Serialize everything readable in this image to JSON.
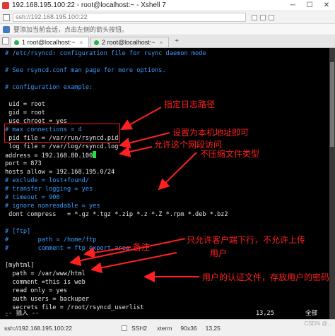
{
  "window": {
    "title": "192.168.195.100:22 - root@localhost:~ - Xshell 7",
    "minimize": "─",
    "maximize": "☐",
    "close": "✕"
  },
  "address_bar": {
    "value": "ssh://192.168.195.100:22"
  },
  "hint": {
    "text": "要添加当前会话，点击左侧的箭头按钮。"
  },
  "tabs": [
    {
      "label": "1 root@localhost:~",
      "close": "×",
      "dot_color": "#2ab24a"
    },
    {
      "label": "2 root@localhost:~",
      "close": "×",
      "dot_color": "#2ab24a"
    }
  ],
  "tab_add": "+",
  "terminal": {
    "lines": [
      {
        "text": "# /etc/rsyncd: configuration file for rsync daemon mode",
        "kind": "comment"
      },
      {
        "text": "",
        "kind": "text"
      },
      {
        "text": "# See rsyncd.conf man page for more options.",
        "kind": "comment"
      },
      {
        "text": "",
        "kind": "text"
      },
      {
        "text": "# configuration example:",
        "kind": "comment"
      },
      {
        "text": "",
        "kind": "text"
      },
      {
        "text": " uid = root",
        "kind": "text"
      },
      {
        "text": " gid = root",
        "kind": "text"
      },
      {
        "text": " use chroot = yes",
        "kind": "text"
      },
      {
        "text": "# max connections = 4",
        "kind": "comment"
      },
      {
        "text": " pid file = /var/run/rsyncd.pid",
        "kind": "text"
      },
      {
        "text": " log file = /var/log/rsyncd.log",
        "kind": "text"
      },
      {
        "text": "address = 192.168.80.100",
        "kind": "cursor"
      },
      {
        "text": "port = 873",
        "kind": "text"
      },
      {
        "text": "hosts allow = 192.168.195.0/24",
        "kind": "text"
      },
      {
        "text": "# exclude = lost+found/",
        "kind": "comment"
      },
      {
        "text": "# transfer logging = yes",
        "kind": "comment"
      },
      {
        "text": "# timeout = 900",
        "kind": "comment"
      },
      {
        "text": "# ignore nonreadable = yes",
        "kind": "comment"
      },
      {
        "text": " dont compress   = *.gz *.tgz *.zip *.z *.Z *.rpm *.deb *.bz2",
        "kind": "text"
      },
      {
        "text": "",
        "kind": "text"
      },
      {
        "text": "# [ftp]",
        "kind": "comment"
      },
      {
        "text": "#        path = /home/ftp",
        "kind": "comment"
      },
      {
        "text": "#        comment = ftp export area",
        "kind": "comment"
      },
      {
        "text": "",
        "kind": "text"
      },
      {
        "text": "[myhtml]",
        "kind": "text"
      },
      {
        "text": "  path = /var/www/html",
        "kind": "text"
      },
      {
        "text": "  comment =this is web",
        "kind": "text"
      },
      {
        "text": "  read only = yes",
        "kind": "text"
      },
      {
        "text": "  auth users = backuper",
        "kind": "text"
      },
      {
        "text": "  secrets file = /root/rsyncd_userlist",
        "kind": "text"
      },
      {
        "text": "~",
        "kind": "tilde"
      },
      {
        "text": "~",
        "kind": "tilde"
      }
    ],
    "mode_line": {
      "mode": "-- 插入 --",
      "position": "13,25",
      "scroll": "全部"
    }
  },
  "annotations": [
    {
      "text": "指定日志路径"
    },
    {
      "text": "设置为本机地址即可"
    },
    {
      "text": "允许这个网段访问"
    },
    {
      "text": "不压缩文件类型"
    },
    {
      "text": "只允许客户端下行，不允许上传"
    },
    {
      "text": "备注"
    },
    {
      "text": "用户"
    },
    {
      "text": "用户的认证文件，存放用户的密码"
    }
  ],
  "annotation_color": "#ff2020",
  "status_bar": {
    "connection": "ssh://192.168.195.100:22",
    "protocol": "SSH2",
    "term": "xterm",
    "size": "90x36",
    "cursor": "13,25",
    "watermark": "CSDN @..."
  }
}
